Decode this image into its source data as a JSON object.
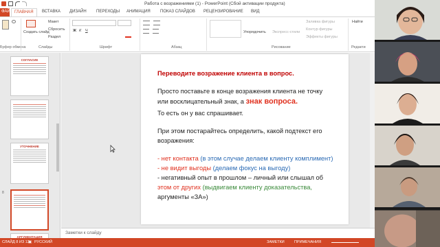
{
  "window": {
    "title": "Работа с возражениями (1) - PowerPoint (Сбой активации продукта)"
  },
  "ribbon_tabs": [
    {
      "label": "ФАЙЛ"
    },
    {
      "label": "ГЛАВНАЯ"
    },
    {
      "label": "ВСТАВКА"
    },
    {
      "label": "ДИЗАЙН"
    },
    {
      "label": "ПЕРЕХОДЫ"
    },
    {
      "label": "АНИМАЦИЯ"
    },
    {
      "label": "ПОКАЗ СЛАЙДОВ"
    },
    {
      "label": "РЕЦЕНЗИРОВАНИЕ"
    },
    {
      "label": "ВИД"
    }
  ],
  "ribbon": {
    "clipboard_label": "Буфер обмена",
    "slides_group_label": "Слайды",
    "font_group_label": "Шрифт",
    "paragraph_group_label": "Абзац",
    "drawing_group_label": "Рисование",
    "editing_group_label": "Редакти",
    "create_slide": "Создать слайд",
    "layout": "Макет",
    "reset": "Сбросить",
    "section": "Раздел",
    "arrange": "Упорядочить",
    "express_styles": "Экспресс-стили",
    "shape_fill": "Заливка фигуры",
    "shape_outline": "Контур фигуры",
    "shape_effects": "Эффекты фигуры",
    "find": "Найти"
  },
  "thumbnails": [
    {
      "title": "СОГЛАСИЕ"
    },
    {
      "title": ""
    },
    {
      "title": "УТОЧНЕНИЕ"
    },
    {
      "title": ""
    },
    {
      "title": "АРГУМЕНТАЦИЯ"
    }
  ],
  "slide": {
    "heading": "Переводите возражение клиента в вопрос.",
    "line1": "Просто поставьте в конце возражения клиента не точку",
    "line2a": "или восклицательный знак, а ",
    "line2b": "знак вопроса.",
    "line3": "То есть он у вас спрашивает.",
    "line4": "При этом постарайтесь определить, какой подтекст его",
    "line5": "возражения:",
    "b1_red": "- нет контакта ",
    "b1_blue": "(в этом случае делаем клиенту комплимент)",
    "b2_red": "- не видит выгоды ",
    "b2_blue": "(делаем фокус на выгоду)",
    "b3_red": "- негативный опыт в прошлом – личный или слышал об",
    "b4_red": "этом от других ",
    "b4_green": "(выдвигаем клиенту доказательства,",
    "b5_green": "аргументы «ЗА»)"
  },
  "notes": {
    "placeholder": "Заметки к слайду"
  },
  "status": {
    "slide_counter": "СЛАЙД 8 ИЗ 12",
    "language": "РУССКИЙ",
    "notes_btn": "ЗАМЕТКИ",
    "comments_btn": "ПРИМЕЧАНИЯ"
  },
  "colors": {
    "accent": "#d24726",
    "heading": "#c00000",
    "blue_text": "#2a6ab4",
    "green_text": "#3a8a3a"
  }
}
